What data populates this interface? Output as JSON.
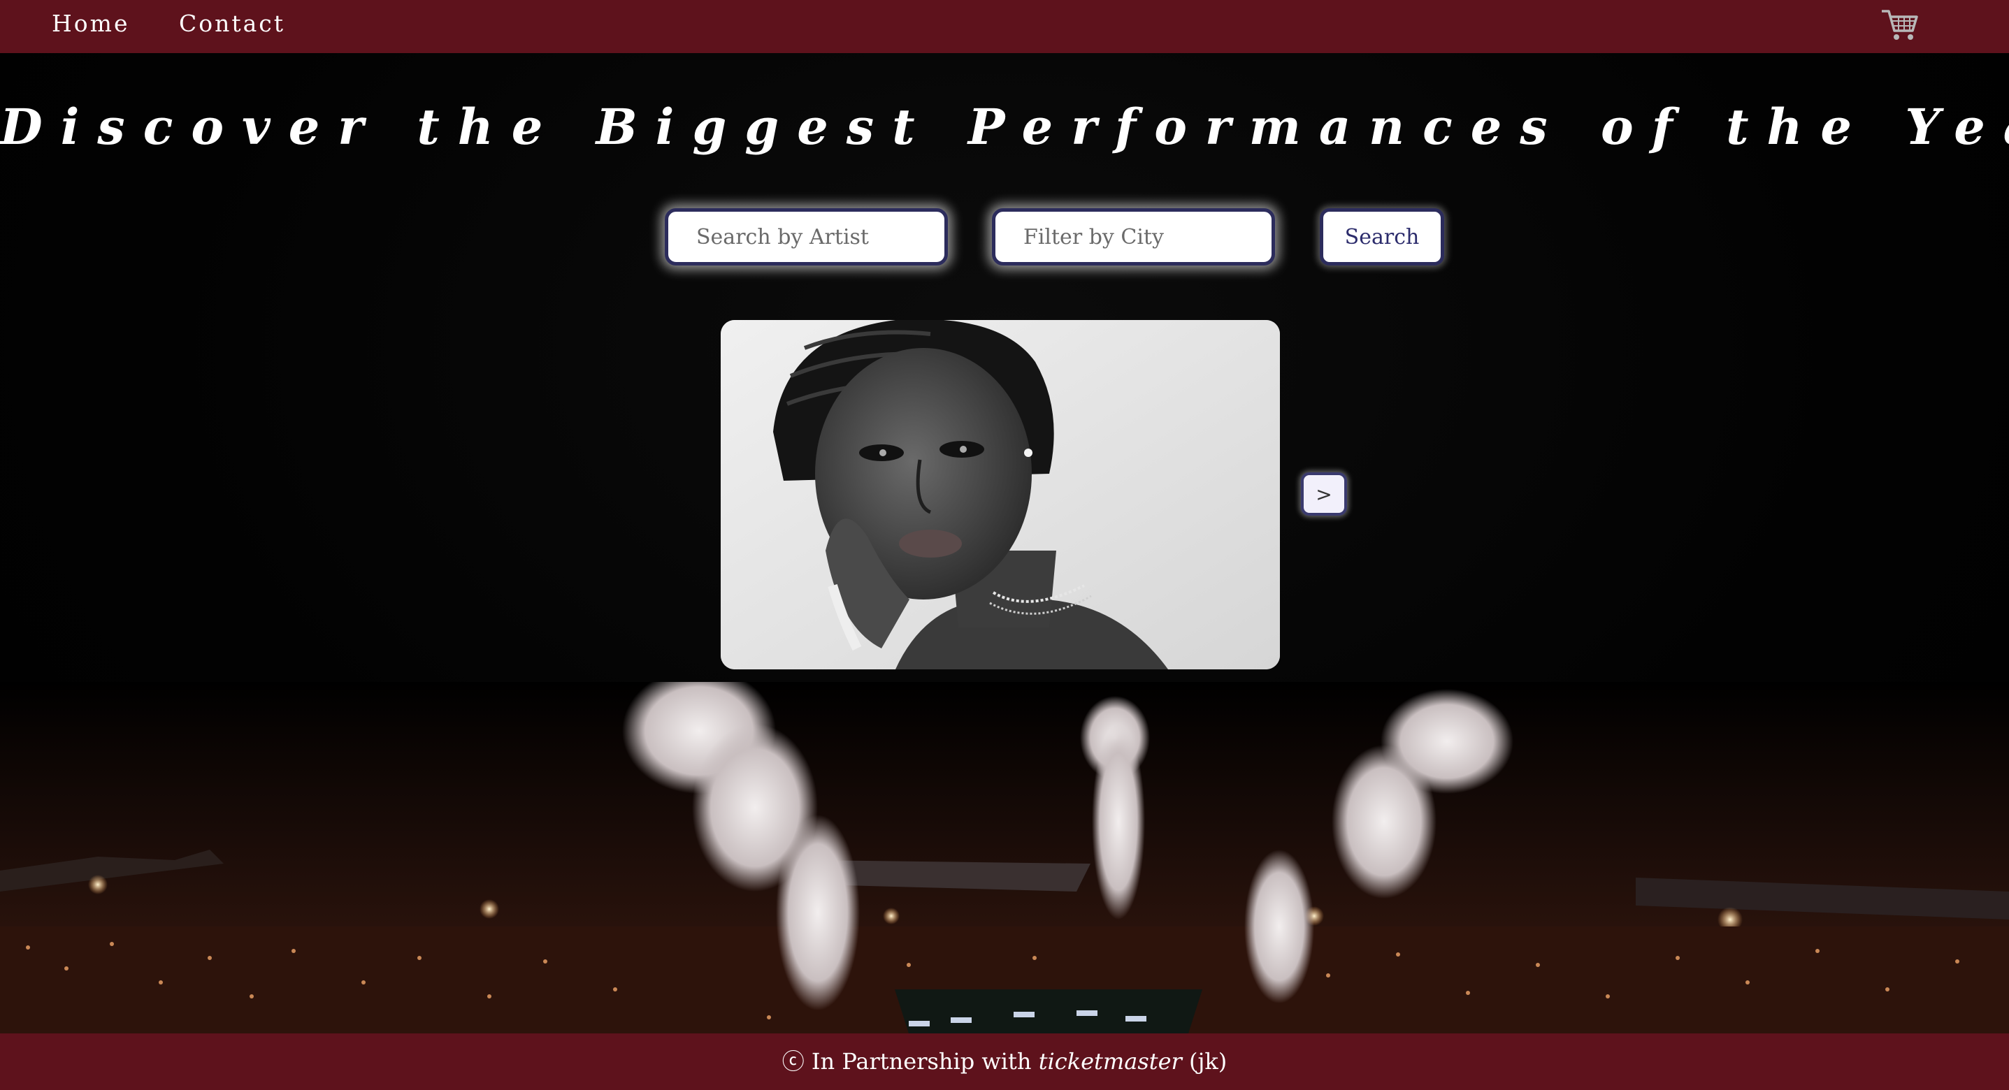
{
  "nav": {
    "home_label": "Home",
    "contact_label": "Contact",
    "cart_icon": "shopping-cart-icon"
  },
  "hero": {
    "title": "Discover the Biggest Performances of the Year"
  },
  "search": {
    "artist_placeholder": "Search by Artist",
    "city_placeholder": "Filter by City",
    "button_label": "Search"
  },
  "carousel": {
    "next_label": ">",
    "image": "black-and-white portrait of an artist"
  },
  "footer": {
    "prefix": "ⓒ In Partnership with",
    "brand": "ticketmaster",
    "suffix": "(jk)"
  },
  "colors": {
    "nav_bg": "#5e121c",
    "footer_bg": "#5e121c",
    "page_bg": "#000000",
    "button_text": "#2c2c6c",
    "field_border": "#2c2c5c"
  }
}
